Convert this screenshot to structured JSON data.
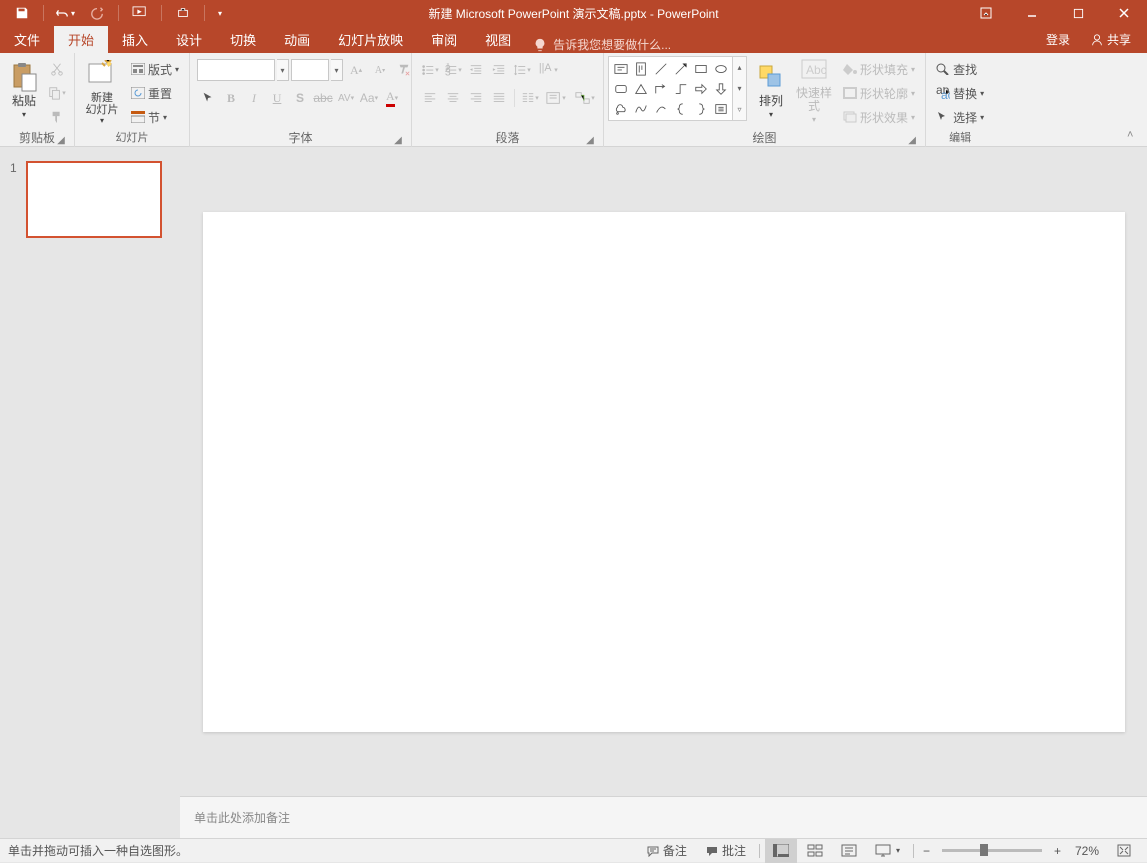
{
  "title": "新建 Microsoft PowerPoint 演示文稿.pptx - PowerPoint",
  "tabs": {
    "file": "文件",
    "home": "开始",
    "insert": "插入",
    "design": "设计",
    "transitions": "切换",
    "animations": "动画",
    "slideshow": "幻灯片放映",
    "review": "审阅",
    "view": "视图"
  },
  "tell_me": "告诉我您想要做什么...",
  "login": "登录",
  "share": "共享",
  "groups": {
    "clipboard": {
      "label": "剪贴板",
      "paste": "粘贴"
    },
    "slides": {
      "label": "幻灯片",
      "new_slide": "新建\n幻灯片",
      "layout": "版式",
      "reset": "重置",
      "section": "节"
    },
    "font": {
      "label": "字体"
    },
    "paragraph": {
      "label": "段落"
    },
    "drawing": {
      "label": "绘图",
      "arrange": "排列",
      "quick_style": "快速样式",
      "fill": "形状填充",
      "outline": "形状轮廓",
      "effects": "形状效果"
    },
    "editing": {
      "label": "编辑",
      "find": "查找",
      "replace": "替换",
      "select": "选择"
    }
  },
  "thumbnails": [
    {
      "num": "1"
    }
  ],
  "notes_placeholder": "单击此处添加备注",
  "statusbar": {
    "left": "单击并拖动可插入一种自选图形。",
    "notes": "备注",
    "comments": "批注",
    "zoom": "72%"
  }
}
